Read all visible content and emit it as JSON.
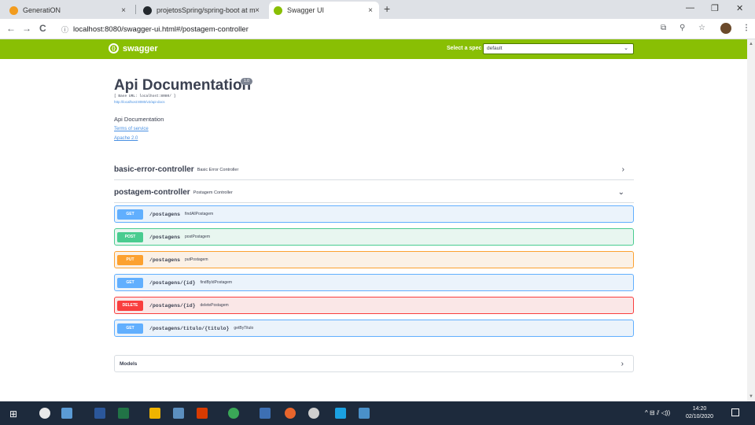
{
  "browser": {
    "tabs": [
      {
        "title": "GeneratiON",
        "close": "×"
      },
      {
        "title": "projetosSpring/spring-boot at m",
        "close": "×"
      },
      {
        "title": "Swagger UI",
        "close": "×"
      }
    ],
    "new_tab": "+",
    "window_controls": [
      "—",
      "❐",
      "✕"
    ],
    "nav": {
      "back": "←",
      "forward": "→",
      "reload": "C"
    },
    "url_info_icon": "ⓘ",
    "url": "localhost:8080/swagger-ui.html#/postagem-controller",
    "addr_icons": [
      "translate-icon",
      "zoom-icon",
      "star-icon",
      "profile-avatar",
      "menu-icon"
    ]
  },
  "swagger": {
    "brand": "swagger",
    "select_label": "Select a spec",
    "select_value": "default",
    "select_arrow": "⌄"
  },
  "info": {
    "title": "Api Documentation",
    "version": "1.0",
    "base_url": "[ Base URL: localhost:8080/ ]",
    "docs_url": "http://localhost:8080/v2/api-docs",
    "description": "Api Documentation",
    "terms": "Terms of service",
    "license": "Apache 2.0"
  },
  "controllers": [
    {
      "name": "basic-error-controller",
      "description": "Basic Error Controller",
      "chevron": "›"
    },
    {
      "name": "postagem-controller",
      "description": "Postagem Controller",
      "chevron": "⌄"
    }
  ],
  "operations": [
    {
      "method": "GET",
      "path": "/postagens",
      "summary": "findAllPostagem"
    },
    {
      "method": "POST",
      "path": "/postagens",
      "summary": "postPostagem"
    },
    {
      "method": "PUT",
      "path": "/postagens",
      "summary": "putPostagem"
    },
    {
      "method": "GET",
      "path": "/postagens/{id}",
      "summary": "findByIdPostagem"
    },
    {
      "method": "DELETE",
      "path": "/postagens/{id}",
      "summary": "deletePostagem"
    },
    {
      "method": "GET",
      "path": "/postagens/titulo/{titulo}",
      "summary": "getByTitulo"
    }
  ],
  "models": {
    "label": "Models",
    "chevron": "›"
  },
  "taskbar": {
    "start": "⊞",
    "tray": "^ ⊟ ⫽ ◁))",
    "time": "14:20",
    "date": "02/10/2020"
  },
  "colors": {
    "swagger_green": "#89bf04",
    "get": "#61affe",
    "post": "#49cc90",
    "put": "#fca130",
    "delete": "#f93e3e"
  }
}
